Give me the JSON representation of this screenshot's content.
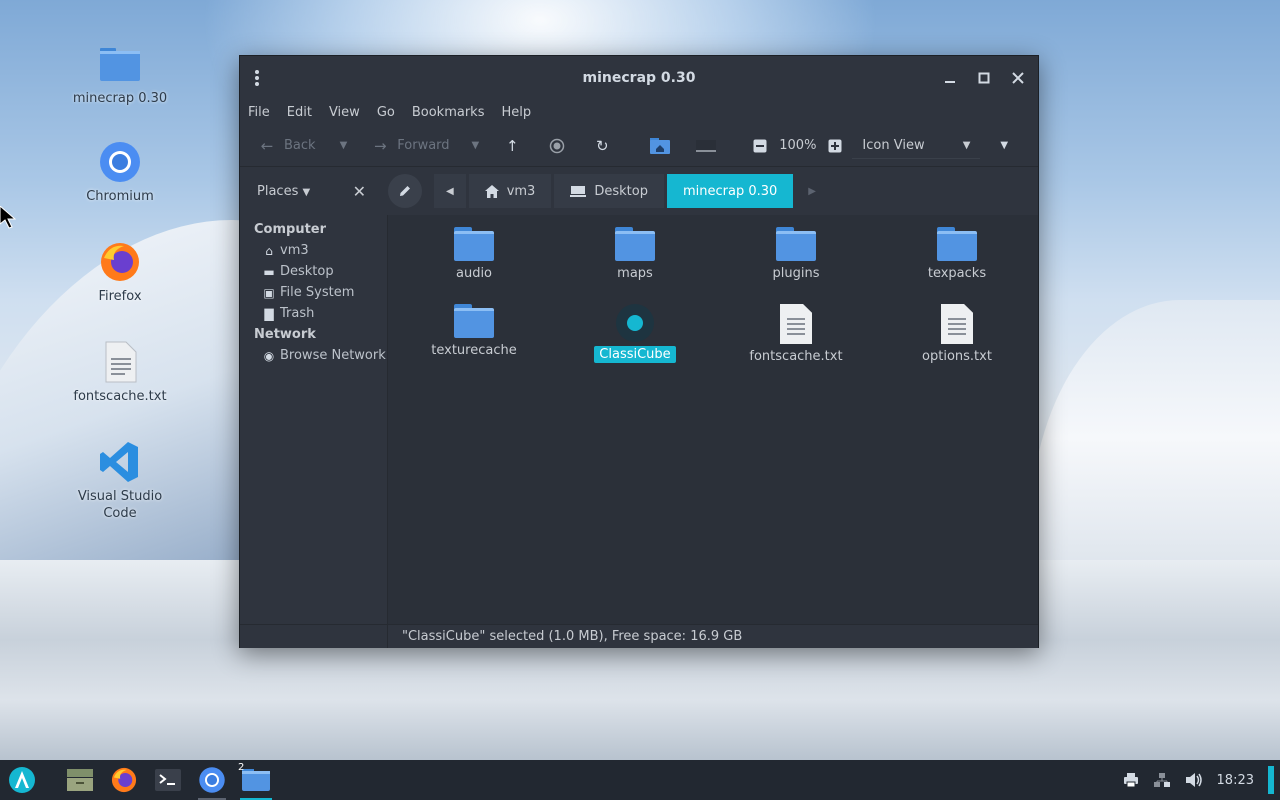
{
  "desktop": {
    "icons": [
      {
        "label": "minecrap 0.30",
        "icon": "folder-icon"
      },
      {
        "label": "Chromium",
        "icon": "chromium-icon"
      },
      {
        "label": "Firefox",
        "icon": "firefox-icon"
      },
      {
        "label": "fontscache.txt",
        "icon": "text-file-icon"
      },
      {
        "label": "Visual Studio\nCode",
        "icon": "vscode-icon"
      }
    ]
  },
  "window": {
    "title": "minecrap 0.30",
    "menu": [
      "File",
      "Edit",
      "View",
      "Go",
      "Bookmarks",
      "Help"
    ],
    "toolbar": {
      "back": "Back",
      "forward": "Forward",
      "zoom": "100%",
      "view_mode": "Icon View"
    },
    "places_label": "Places",
    "breadcrumbs": [
      "vm3",
      "Desktop",
      "minecrap 0.30"
    ],
    "sidebar": {
      "computer_header": "Computer",
      "computer_items": [
        {
          "label": "vm3",
          "icon": "home-icon"
        },
        {
          "label": "Desktop",
          "icon": "desktop-icon"
        },
        {
          "label": "File System",
          "icon": "drive-icon"
        },
        {
          "label": "Trash",
          "icon": "trash-icon"
        }
      ],
      "network_header": "Network",
      "network_items": [
        {
          "label": "Browse Network",
          "icon": "network-icon"
        }
      ]
    },
    "files": [
      {
        "name": "audio",
        "type": "folder"
      },
      {
        "name": "maps",
        "type": "folder"
      },
      {
        "name": "plugins",
        "type": "folder"
      },
      {
        "name": "texpacks",
        "type": "folder"
      },
      {
        "name": "texturecache",
        "type": "folder"
      },
      {
        "name": "ClassiCube",
        "type": "executable",
        "selected": true
      },
      {
        "name": "fontscache.txt",
        "type": "text"
      },
      {
        "name": "options.txt",
        "type": "text"
      }
    ],
    "status": "\"ClassiCube\" selected (1.0 MB), Free space: 16.9 GB"
  },
  "taskbar": {
    "badge_count": "2",
    "clock": "18:23"
  },
  "colors": {
    "accent": "#15b7d1",
    "folder": "#5294e2",
    "window_bg": "#2b3039"
  }
}
